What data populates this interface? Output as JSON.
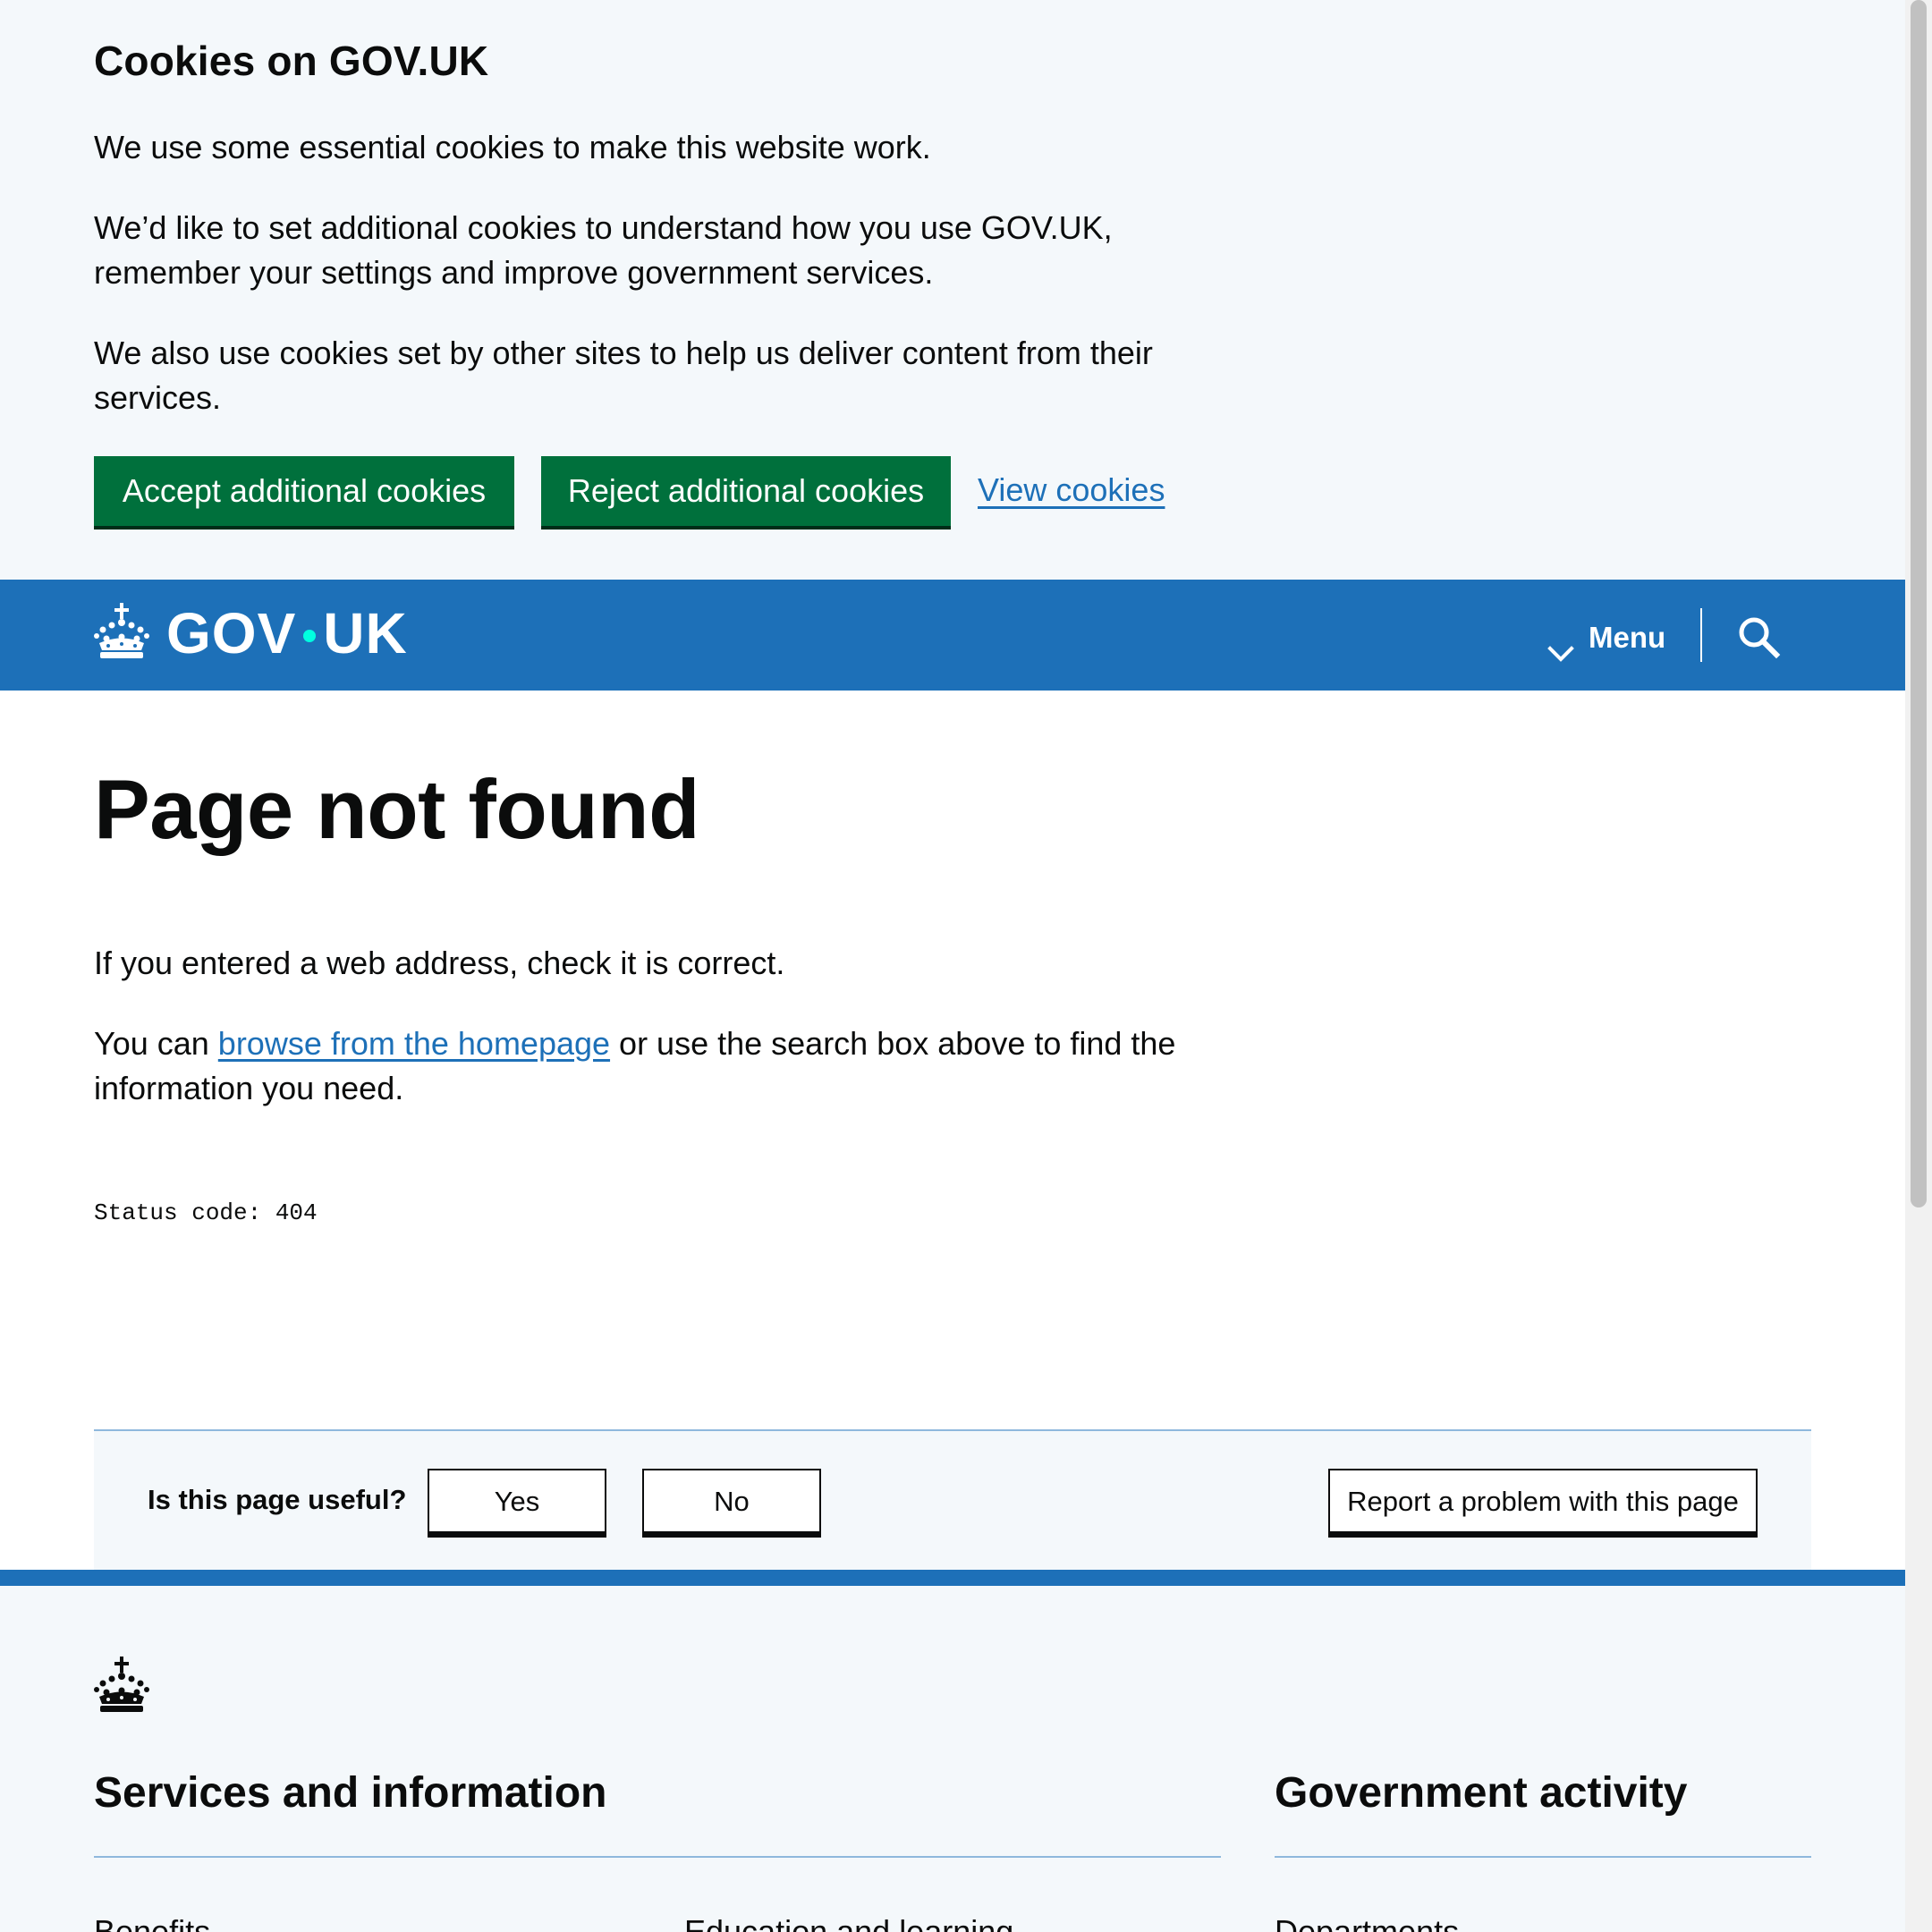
{
  "cookie_banner": {
    "title": "Cookies on GOV.UK",
    "paragraphs": [
      "We use some essential cookies to make this website work.",
      "We’d like to set additional cookies to understand how you use GOV.UK, remember your settings and improve government services.",
      "We also use cookies set by other sites to help us deliver content from their services."
    ],
    "buttons": {
      "accept": "Accept additional cookies",
      "reject": "Reject additional cookies"
    },
    "view_link": "View cookies"
  },
  "header": {
    "logo_left": "GOV",
    "logo_right": "UK",
    "menu_label": "Menu",
    "icons": {
      "crown": "crown-icon",
      "chevron": "chevron-down-icon",
      "search": "search-icon"
    }
  },
  "main": {
    "title": "Page not found",
    "paragraph_1": "If you entered a web address, check it is correct.",
    "paragraph_2_prefix": "You can ",
    "homepage_link": "browse from the homepage",
    "paragraph_2_suffix": " or use the search box above to find the information you need.",
    "status_code": "Status code: 404"
  },
  "feedback": {
    "question": "Is this page useful?",
    "yes": "Yes",
    "no": "No",
    "report": "Report a problem with this page"
  },
  "footer": {
    "services_heading": "Services and information",
    "activity_heading": "Government activity",
    "services_links": [
      "Benefits",
      "Education and learning"
    ],
    "activity_links": [
      "Departments"
    ]
  },
  "colors": {
    "gov_blue": "#1d70b8",
    "button_green": "#00703c",
    "light_background": "#f4f8fb",
    "text_black": "#0b0c0c",
    "logo_dot": "#00ffe0"
  }
}
